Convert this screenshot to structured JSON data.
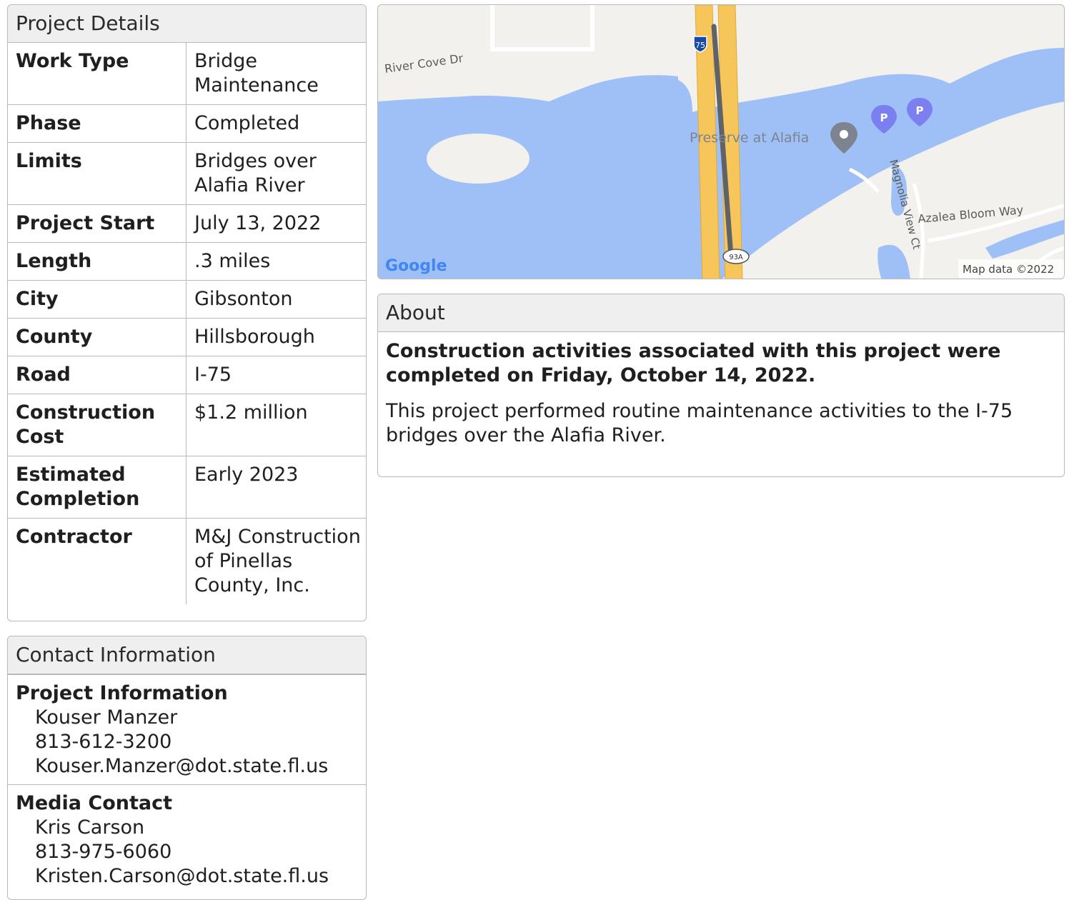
{
  "details": {
    "title": "Project Details",
    "rows": [
      {
        "label": "Work Type",
        "value": "Bridge Maintenance"
      },
      {
        "label": "Phase",
        "value": "Completed"
      },
      {
        "label": "Limits",
        "value": "Bridges over Alafia River"
      },
      {
        "label": "Project Start",
        "value": "July 13, 2022"
      },
      {
        "label": "Length",
        "value": ".3 miles"
      },
      {
        "label": "City",
        "value": "Gibsonton"
      },
      {
        "label": "County",
        "value": "Hillsborough"
      },
      {
        "label": "Road",
        "value": "I-75"
      },
      {
        "label": "Construction Cost",
        "value": "$1.2 million"
      },
      {
        "label": "Estimated Completion",
        "value": "Early 2023"
      },
      {
        "label": "Contractor",
        "value": "M&J Construction of Pinellas County, Inc."
      }
    ]
  },
  "contacts": {
    "title": "Contact Information",
    "items": [
      {
        "role": "Project Information",
        "name": "Kouser Manzer",
        "phone": "813-612-3200",
        "email": "Kouser.Manzer@dot.state.fl.us"
      },
      {
        "role": "Media Contact",
        "name": "Kris Carson",
        "phone": "813-975-6060",
        "email": "Kristen.Carson@dot.state.fl.us"
      }
    ]
  },
  "map": {
    "labels": {
      "street1": "River Cove Dr",
      "poi": "Preserve at Alafia",
      "street2": "Magnolia View Ct",
      "street3": "Azalea Bloom Way",
      "shield_interstate": "75",
      "shield_route": "93A",
      "logo": "Google",
      "attribution": "Map data ©2022",
      "parking": "P"
    },
    "colors": {
      "water": "#9ec0f6",
      "land": "#f2f1ee",
      "highway": "#f6c65b",
      "project_line": "#5f6368",
      "poi": "#7d8490",
      "parking": "#7b7ff0"
    }
  },
  "about": {
    "title": "About",
    "bold": "Construction activities associated with this project were completed on Friday, October 14, 2022.",
    "text": "This project performed routine maintenance activities to the I-75 bridges over the Alafia River."
  }
}
